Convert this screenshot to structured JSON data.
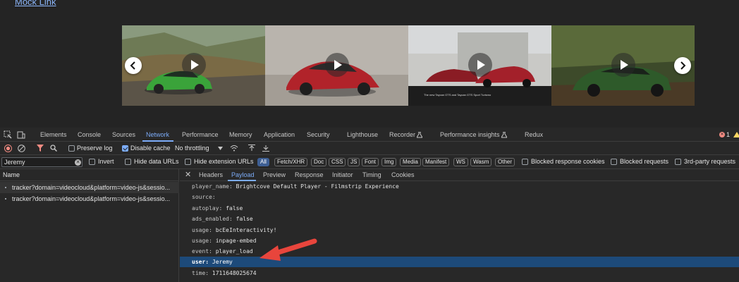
{
  "page": {
    "mock_link": "Mock Link",
    "carousel": {
      "slides": [
        {
          "name": "green-porsche-911",
          "caption": ""
        },
        {
          "name": "red-classic-porsche",
          "caption": ""
        },
        {
          "name": "red-taycan-sport-turismo",
          "caption": "The new Taycan GTS and Taycan GTS Sport Turismo"
        },
        {
          "name": "green-taycan-cross-turismo",
          "caption": ""
        }
      ]
    }
  },
  "devtools": {
    "tabs": [
      "Elements",
      "Console",
      "Sources",
      "Network",
      "Performance",
      "Memory",
      "Application",
      "Security",
      "Lighthouse",
      "Recorder",
      "Performance insights",
      "Redux"
    ],
    "active_tab": "Network",
    "error_count": "1",
    "toolbar": {
      "preserve_log": "Preserve log",
      "disable_cache": "Disable cache",
      "throttling": "No throttling"
    },
    "filter": {
      "value": "Jeremy",
      "invert": "Invert",
      "hide_data_urls": "Hide data URLs",
      "hide_extension_urls": "Hide extension URLs",
      "types": [
        "All",
        "Fetch/XHR",
        "Doc",
        "CSS",
        "JS",
        "Font",
        "Img",
        "Media",
        "Manifest",
        "WS",
        "Wasm",
        "Other"
      ],
      "blocked_response_cookies": "Blocked response cookies",
      "blocked_requests": "Blocked requests",
      "third_party": "3rd-party requests"
    },
    "requests": {
      "header": "Name",
      "items": [
        "tracker?domain=videocloud&platform=video-js&sessio...",
        "tracker?domain=videocloud&platform=video-js&sessio..."
      ]
    },
    "detail": {
      "close": "✕",
      "tabs": [
        "Headers",
        "Payload",
        "Preview",
        "Response",
        "Initiator",
        "Timing",
        "Cookies"
      ],
      "active_tab": "Payload",
      "payload": [
        {
          "key": "player_name:",
          "value": "Brightcove Default Player - Filmstrip Experience"
        },
        {
          "key": "source:",
          "value": ""
        },
        {
          "key": "autoplay:",
          "value": "false"
        },
        {
          "key": "ads_enabled:",
          "value": "false"
        },
        {
          "key": "usage:",
          "value": "bcEeInteractivity!"
        },
        {
          "key": "usage:",
          "value": "inpage-embed"
        },
        {
          "key": "event:",
          "value": "player_load"
        },
        {
          "key": "user:",
          "value": "Jeremy"
        },
        {
          "key": "time:",
          "value": "1711648025674"
        }
      ],
      "highlighted_index": 7
    }
  },
  "colors": {
    "accent": "#7cacf8",
    "highlight_row": "#1d4a7a",
    "annotation_arrow": "#e8453c"
  }
}
